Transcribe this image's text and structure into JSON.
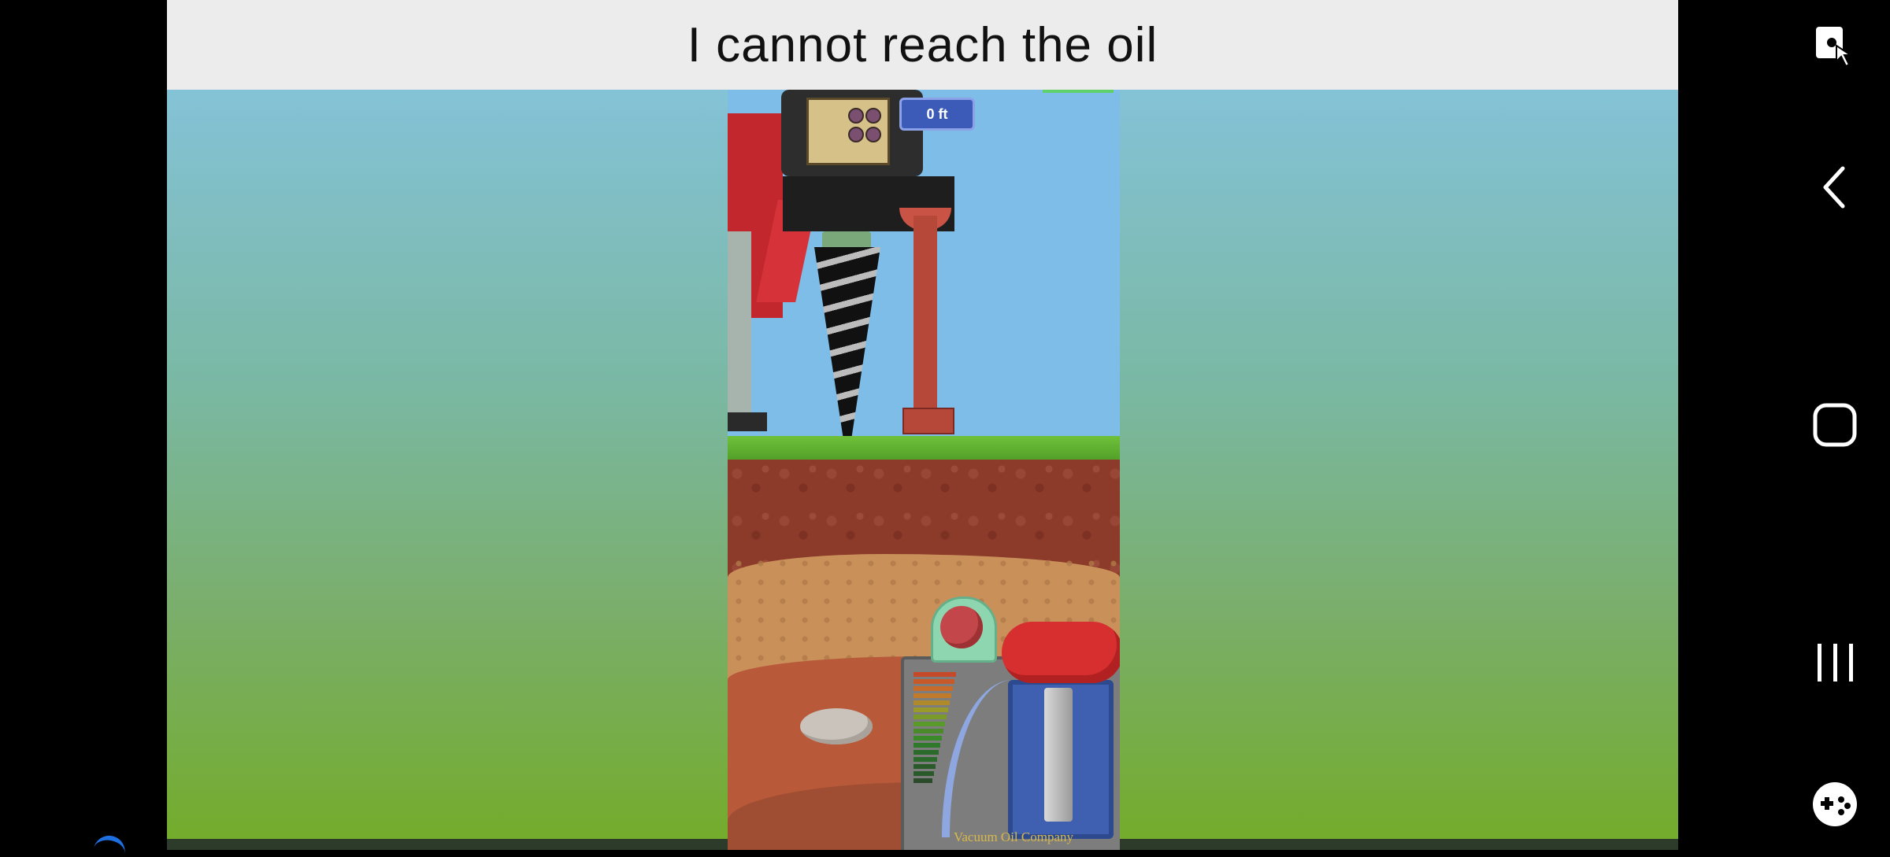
{
  "title": "I cannot reach the oil",
  "game": {
    "depth_label": "0 ft",
    "company_label": "Vacuum Oil Company",
    "meter_colors": [
      "#c44a2a",
      "#c85a2a",
      "#c86a2a",
      "#c07a2a",
      "#b08a2a",
      "#9a9a2a",
      "#7a9a2a",
      "#5a9a2a",
      "#4a8a2a",
      "#3a8a2a",
      "#2f7a2a",
      "#2a6a2a",
      "#2a6a2a",
      "#2a5a2a",
      "#2a5a2a",
      "#2a4a2a"
    ]
  },
  "nav": {
    "icons": [
      "screen-lock-icon",
      "back-icon",
      "home-icon",
      "recents-icon",
      "game-tools-icon"
    ]
  },
  "colors": {
    "title_bg": "#ececec",
    "sky": "#7fbde9",
    "grass": "#5fae2c",
    "badge": "#3c5bb8",
    "lever": "#d72f2f"
  }
}
